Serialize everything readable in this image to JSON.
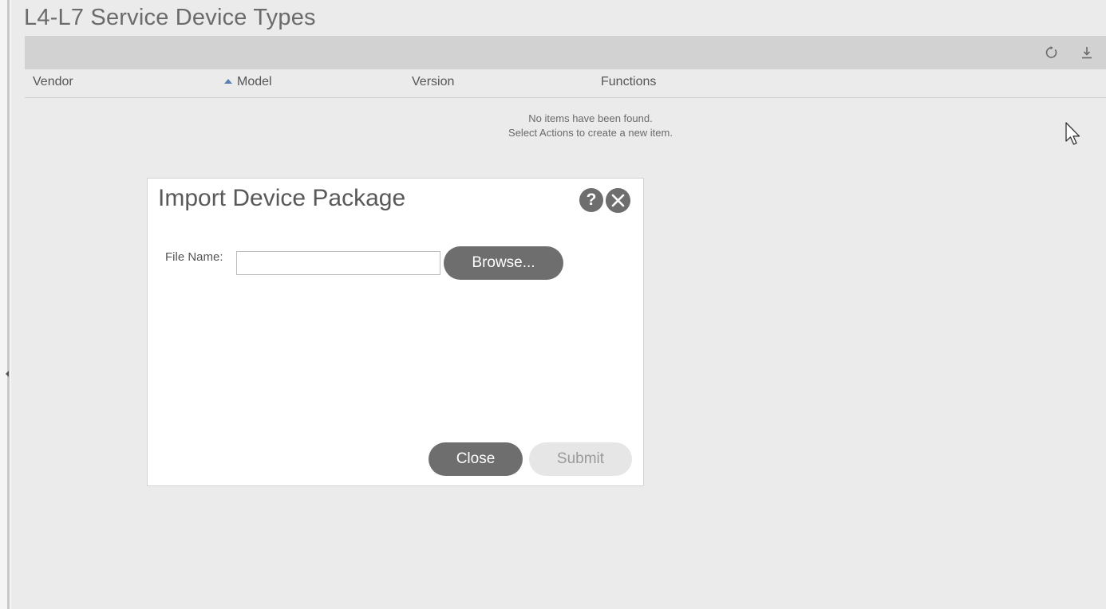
{
  "page": {
    "title": "L4-L7 Service Device Types"
  },
  "toolbar": {
    "refresh_icon": "refresh-icon",
    "download_icon": "download-icon"
  },
  "grid": {
    "columns": [
      {
        "label": "Vendor"
      },
      {
        "label": "Model",
        "sorted": "ascending"
      },
      {
        "label": "Version"
      },
      {
        "label": "Functions"
      }
    ],
    "empty_line1": "No items have been found.",
    "empty_line2": "Select Actions to create a new item."
  },
  "modal": {
    "title": "Import Device Package",
    "help_glyph": "?",
    "file_label": "File Name:",
    "file_value": "",
    "browse_label": "Browse...",
    "close_label": "Close",
    "submit_label": "Submit"
  },
  "colors": {
    "background": "#ebebeb",
    "toolbar": "#d2d2d2",
    "button_dark": "#6e6e6e",
    "button_disabled": "#e6e6e6",
    "sort_indicator": "#5a7fb0"
  }
}
